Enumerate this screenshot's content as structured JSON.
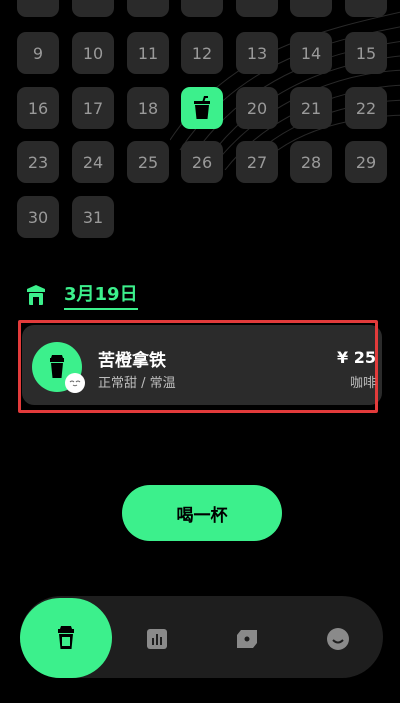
{
  "calendar": {
    "partial_row": [
      "",
      "",
      "",
      "",
      "",
      "",
      ""
    ],
    "rows": [
      [
        "9",
        "10",
        "11",
        "12",
        "13",
        "14",
        "15"
      ],
      [
        "16",
        "17",
        "18",
        "19",
        "20",
        "21",
        "22"
      ],
      [
        "23",
        "24",
        "25",
        "26",
        "27",
        "28",
        "29"
      ],
      [
        "30",
        "31"
      ]
    ],
    "selected_day": "19"
  },
  "selected_date": {
    "label": "3月19日"
  },
  "record": {
    "name": "苦橙拿铁",
    "detail": "正常甜 / 常温",
    "price": "¥ 25",
    "category": "咖啡"
  },
  "actions": {
    "drink_button": "喝一杯"
  },
  "nav": {
    "items": [
      "cup-icon",
      "chart-icon",
      "ticket-icon",
      "smile-icon"
    ],
    "active": "cup-icon"
  },
  "colors": {
    "accent": "#3cf08c",
    "background": "#000000",
    "cell": "#2a2a2a",
    "highlight_border": "#e23b3b"
  }
}
